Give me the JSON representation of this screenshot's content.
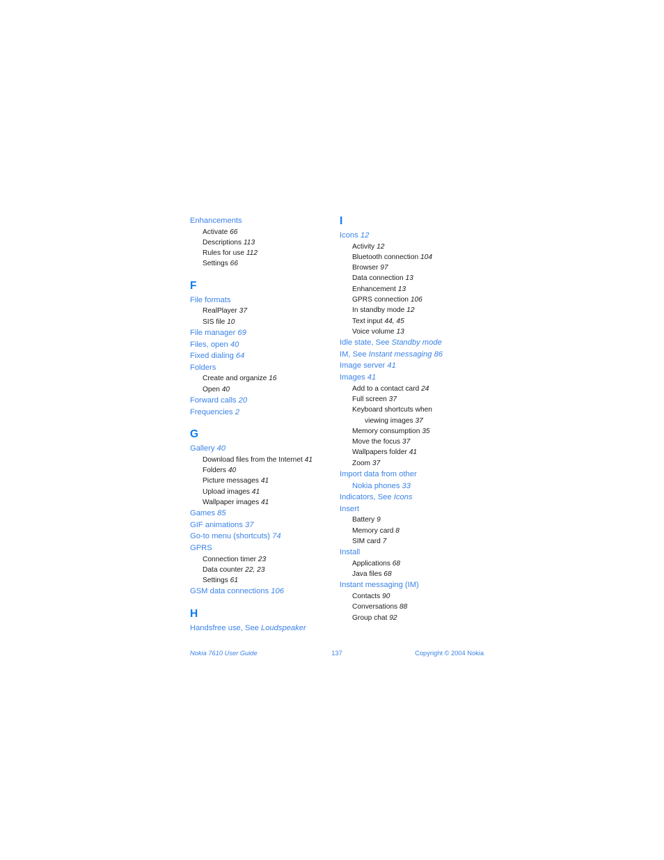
{
  "document": {
    "page_number": "137",
    "footer_left": "Nokia 7610 User Guide",
    "footer_right": "Copyright © 2004 Nokia",
    "accent_color": "#3A82E8",
    "section_letter_color": "#0B7BF5",
    "body_text_color": "#1a1a1a"
  },
  "columns": [
    {
      "name": "left-column",
      "sections": [
        {
          "letter": "",
          "entries": [
            {
              "level": 1,
              "text": "Enhancements"
            },
            {
              "level": 2,
              "text": "Activate 66"
            },
            {
              "level": 2,
              "text": "Descriptions 113"
            },
            {
              "level": 2,
              "text": "Rules for use 112"
            },
            {
              "level": 2,
              "text": "Settings 66"
            }
          ]
        },
        {
          "letter": "F",
          "entries": [
            {
              "level": 1,
              "text": "File formats"
            },
            {
              "level": 2,
              "text": "RealPlayer 37"
            },
            {
              "level": 2,
              "text": "SIS file 10"
            },
            {
              "level": 1,
              "text": "File manager 69"
            },
            {
              "level": 1,
              "text": "Files, open 40"
            },
            {
              "level": 1,
              "text": "Fixed dialing 64"
            },
            {
              "level": 1,
              "text": "Folders"
            },
            {
              "level": 2,
              "text": "Create and organize 16"
            },
            {
              "level": 2,
              "text": "Open 40"
            },
            {
              "level": 1,
              "text": "Forward calls 20"
            },
            {
              "level": 1,
              "text": "Frequencies 2"
            }
          ]
        },
        {
          "letter": "G",
          "entries": [
            {
              "level": 1,
              "text": "Gallery 40"
            },
            {
              "level": 2,
              "text": "Download files from the Internet 41"
            },
            {
              "level": 2,
              "text": "Folders 40"
            },
            {
              "level": 2,
              "text": "Picture messages 41"
            },
            {
              "level": 2,
              "text": "Upload images 41"
            },
            {
              "level": 2,
              "text": "Wallpaper images 41"
            },
            {
              "level": 1,
              "text": "Games 85"
            },
            {
              "level": 1,
              "text": "GIF animations 37"
            },
            {
              "level": 1,
              "text": "Go-to menu (shortcuts) 74"
            },
            {
              "level": 1,
              "text": "GPRS"
            },
            {
              "level": 2,
              "text": "Connection timer 23"
            },
            {
              "level": 2,
              "text": "Data counter 22, 23"
            },
            {
              "level": 2,
              "text": "Settings 61"
            },
            {
              "level": 1,
              "text": "GSM data connections 106"
            }
          ]
        },
        {
          "letter": "H",
          "entries": [
            {
              "level": 1,
              "text": "Handsfree use, See Loudspeaker"
            }
          ]
        }
      ]
    },
    {
      "name": "right-column",
      "sections": [
        {
          "letter": "I",
          "entries": [
            {
              "level": 1,
              "text": "Icons 12"
            },
            {
              "level": 2,
              "text": "Activity 12"
            },
            {
              "level": 2,
              "text": "Bluetooth connection 104"
            },
            {
              "level": 2,
              "text": "Browser 97"
            },
            {
              "level": 2,
              "text": "Data connection 13"
            },
            {
              "level": 2,
              "text": "Enhancement 13"
            },
            {
              "level": 2,
              "text": "GPRS connection 106"
            },
            {
              "level": 2,
              "text": "In standby mode 12"
            },
            {
              "level": 2,
              "text": "Text input 44, 45"
            },
            {
              "level": 2,
              "text": "Voice volume 13"
            },
            {
              "level": 1,
              "text": "Idle state, See Standby mode"
            },
            {
              "level": 1,
              "text": "IM, See Instant messaging 86"
            },
            {
              "level": 1,
              "text": "Image server 41"
            },
            {
              "level": 1,
              "text": "Images 41"
            },
            {
              "level": 2,
              "text": "Add to a contact card 24"
            },
            {
              "level": 2,
              "text": "Full screen 37"
            },
            {
              "level": 2,
              "text": "Keyboard shortcuts when"
            },
            {
              "level": 2,
              "text": "viewing images 37",
              "continuation": true
            },
            {
              "level": 2,
              "text": "Memory consumption 35"
            },
            {
              "level": 2,
              "text": "Move the focus 37"
            },
            {
              "level": 2,
              "text": "Wallpapers folder 41"
            },
            {
              "level": 2,
              "text": "Zoom 37"
            },
            {
              "level": 1,
              "text": "Import data from other"
            },
            {
              "level": 1,
              "text": "Nokia phones 33",
              "continuation": true
            },
            {
              "level": 1,
              "text": "Indicators, See Icons"
            },
            {
              "level": 1,
              "text": "Insert"
            },
            {
              "level": 2,
              "text": "Battery 9"
            },
            {
              "level": 2,
              "text": "Memory card 8"
            },
            {
              "level": 2,
              "text": "SIM card 7"
            },
            {
              "level": 1,
              "text": "Install"
            },
            {
              "level": 2,
              "text": "Applications 68"
            },
            {
              "level": 2,
              "text": "Java files 68"
            },
            {
              "level": 1,
              "text": "Instant messaging (IM)"
            },
            {
              "level": 2,
              "text": "Contacts 90"
            },
            {
              "level": 2,
              "text": "Conversations 88"
            },
            {
              "level": 2,
              "text": "Group chat 92"
            }
          ]
        }
      ]
    }
  ]
}
